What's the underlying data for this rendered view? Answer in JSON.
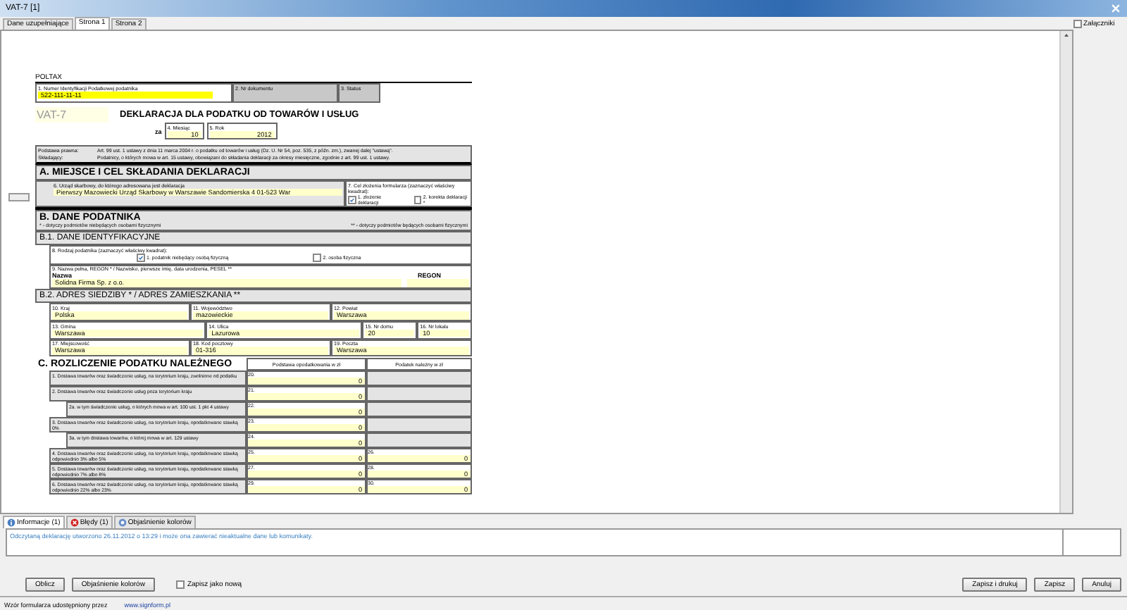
{
  "window": {
    "title": "VAT-7 [1]"
  },
  "tabs": [
    {
      "label": "Dane uzupełniające",
      "selected": false
    },
    {
      "label": "Strona 1",
      "selected": true
    },
    {
      "label": "Strona 2",
      "selected": false
    }
  ],
  "attachments": {
    "label": "Załączniki"
  },
  "form": {
    "system": "POLTAX",
    "nip": {
      "label": "1. Numer Identyfikacji Podatkowej podatnika",
      "value": "522-111-11-11"
    },
    "doc_number": {
      "label": "2. Nr dokumentu"
    },
    "status": {
      "label": "3. Status"
    },
    "symbol": "VAT-7",
    "title": "DEKLARACJA DLA PODATKU OD TOWARÓW I USŁUG",
    "period_prefix": "za",
    "month": {
      "label": "4. Miesiąc",
      "value": "10"
    },
    "year": {
      "label": "5. Rok",
      "value": "2012"
    },
    "legal": [
      {
        "label": "Podstawa prawna:",
        "text": "Art. 99 ust. 1 ustawy z dnia 11 marca 2004 r. o podatku od towarów i usług (Dz. U. Nr 54, poz. 535, z późn. zm.), zwanej dalej \"ustawą\"."
      },
      {
        "label": "Składający:",
        "text": "Podatnicy, o których mowa w art. 15 ustawy, obowiązani do składania deklaracji za okresy miesięczne, zgodnie z art. 99 ust. 1 ustawy."
      }
    ],
    "section_a": {
      "heading": "A. MIEJSCE I CEL SKŁADANIA DEKLARACJI",
      "office": {
        "label": "6. Urząd skarbowy, do którego adresowana jest deklaracja",
        "value": "Pierwszy Mazowiecki Urząd Skarbowy w Warszawie  Sandomierska 4 01-523 War"
      },
      "purpose": {
        "label": "7. Cel złożenia formularza (zaznaczyć właściwy kwadrat):",
        "options": [
          {
            "label": "1. złożenie deklaracji",
            "checked": true
          },
          {
            "label": "2. korekta deklaracji *",
            "checked": false
          }
        ]
      }
    },
    "section_b": {
      "heading": "B. DANE PODATNIKA",
      "notes": [
        "* - dotyczy podmiotów niebędących osobami fizycznymi",
        "** - dotyczy podmiotów będących osobami fizycznymi"
      ],
      "b1": {
        "heading": "B.1. DANE IDENTYFIKACYJNE",
        "taxpayer_type": {
          "label": "8. Rodzaj podatnika (zaznaczyć właściwy kwadrat):",
          "options": [
            {
              "label": "1. podatnik niebędący osobą fizyczną",
              "checked": true
            },
            {
              "label": "2. osoba fizyczna",
              "checked": false
            }
          ]
        },
        "name": {
          "label": "9. Nazwa pełna, REGON * / Nazwisko, pierwsze imię, data urodzenia, PESEL **",
          "name_caption": "Nazwa",
          "regon_caption": "REGON",
          "value": "Solidna Firma Sp. z o.o."
        }
      },
      "b2": {
        "heading": "B.2. ADRES SIEDZIBY * / ADRES ZAMIESZKANIA **",
        "rows": [
          [
            {
              "label": "10. Kraj",
              "value": "Polska"
            },
            {
              "label": "11. Województwo",
              "value": "mazowieckie"
            },
            {
              "label": "12. Powiat",
              "value": "Warszawa"
            }
          ],
          [
            {
              "label": "13. Gmina",
              "value": "Warszawa"
            },
            {
              "label": "14. Ulica",
              "value": "Lazurowa"
            },
            {
              "label": "15. Nr domu",
              "value": "20"
            },
            {
              "label": "16. Nr lokalu",
              "value": "10"
            }
          ],
          [
            {
              "label": "17. Miejscowość",
              "value": "Warszawa"
            },
            {
              "label": "18. Kod pocztowy",
              "value": "01-316"
            },
            {
              "label": "19. Poczta",
              "value": "Warszawa"
            }
          ]
        ]
      }
    },
    "section_c": {
      "heading": "C. ROZLICZENIE PODATKU NALEŻNEGO",
      "columns": [
        "Podstawa opodatkowania w zł",
        "Podatek należny w zł"
      ],
      "rows": [
        {
          "label": "1. Dostawa towarów oraz świadczenie usług, na terytorium kraju, zwolnione od podatku",
          "base": {
            "number": "20.",
            "value": "0"
          }
        },
        {
          "label": "2. Dostawa towarów oraz świadczenie usług poza terytorium kraju",
          "base": {
            "number": "21.",
            "value": "0"
          },
          "children": [
            {
              "label": "2a. w tym świadczenie usług, o których mowa w art. 100 ust. 1 pkt 4 ustawy",
              "base": {
                "number": "22.",
                "value": "0"
              }
            }
          ]
        },
        {
          "label": "3. Dostawa towarów oraz świadczenie usług, na terytorium kraju, opodatkowane stawką 0%",
          "base": {
            "number": "23.",
            "value": "0"
          },
          "children": [
            {
              "label": "3a. w tym dostawa towarów, o której mowa w art. 129 ustawy",
              "base": {
                "number": "24.",
                "value": "0"
              }
            }
          ]
        },
        {
          "label": "4. Dostawa towarów oraz świadczenie usług, na terytorium kraju, opodatkowane stawką odpowiednio 3% albo 5%",
          "base": {
            "number": "25.",
            "value": "0"
          },
          "tax": {
            "number": "26.",
            "value": "0"
          }
        },
        {
          "label": "5. Dostawa towarów oraz świadczenie usług, na terytorium kraju, opodatkowane stawką odpowiednio 7% albo 8%",
          "base": {
            "number": "27.",
            "value": "0"
          },
          "tax": {
            "number": "28.",
            "value": "0"
          }
        },
        {
          "label": "6. Dostawa towarów oraz świadczenie usług, na terytorium kraju, opodatkowane stawką odpowiednio 22% albo 23%",
          "base": {
            "number": "29.",
            "value": "0"
          },
          "tax": {
            "number": "30.",
            "value": "0"
          }
        }
      ]
    }
  },
  "messages": {
    "tabs": [
      {
        "label": "Informacje (1)",
        "kind": "info",
        "selected": true
      },
      {
        "label": "Błędy (1)",
        "kind": "error",
        "selected": false
      },
      {
        "label": "Objaśnienie kolorów",
        "kind": "legend",
        "selected": false
      }
    ],
    "text": "Odczytaną deklarację utworzono 26.11.2012 o 13:29 i może ona zawierać nieaktualne dane lub komunikaty."
  },
  "buttons_left": [
    "Oblicz",
    "Objaśnienie kolorów"
  ],
  "save_as_new": {
    "label": "Zapisz jako nową",
    "checked": false
  },
  "buttons_right": [
    "Zapisz i drukuj",
    "Zapisz",
    "Anuluj"
  ],
  "status_bar": {
    "text": "Wzór formularza udostępniony przez",
    "link": "www.signform.pl"
  }
}
